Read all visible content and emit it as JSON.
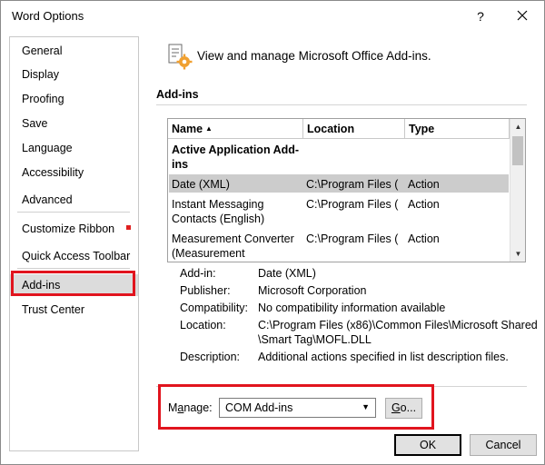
{
  "window": {
    "title": "Word Options",
    "help_label": "?"
  },
  "sidebar": {
    "items": [
      {
        "label": "General"
      },
      {
        "label": "Display"
      },
      {
        "label": "Proofing"
      },
      {
        "label": "Save"
      },
      {
        "label": "Language"
      },
      {
        "label": "Accessibility"
      },
      {
        "label": "Advanced"
      },
      {
        "label": "Customize Ribbon"
      },
      {
        "label": "Quick Access Toolbar"
      },
      {
        "label": "Add-ins"
      },
      {
        "label": "Trust Center"
      }
    ],
    "selected": "Add-ins"
  },
  "header": {
    "title": "View and manage Microsoft Office Add-ins.",
    "icon": "addins-gear-icon"
  },
  "addins": {
    "section_title": "Add-ins",
    "columns": [
      "Name",
      "Location",
      "Type"
    ],
    "group_title_line1": "Active Application Add-",
    "group_title_line2": "ins",
    "rows": [
      {
        "name_line1": "Date (XML)",
        "name_line2": "",
        "location": "C:\\Program Files (",
        "type": "Action"
      },
      {
        "name_line1": "Instant Messaging",
        "name_line2": "Contacts (English)",
        "location": "C:\\Program Files (",
        "type": "Action"
      },
      {
        "name_line1": "Measurement Converter",
        "name_line2": "(Measurement",
        "location": "C:\\Program Files (",
        "type": "Action"
      }
    ]
  },
  "details": {
    "addin_label": "Add-in:",
    "addin_value": "Date (XML)",
    "publisher_label": "Publisher:",
    "publisher_value": "Microsoft Corporation",
    "compat_label": "Compatibility:",
    "compat_value": "No compatibility information available",
    "location_label": "Location:",
    "location_value_line1": "C:\\Program Files (x86)\\Common Files\\Microsoft Shared",
    "location_value_line2": "\\Smart Tag\\MOFL.DLL",
    "description_label": "Description:",
    "description_value": "Additional actions specified in list description files."
  },
  "manage": {
    "label_prefix": "M",
    "label_accel": "a",
    "label_suffix": "nage:",
    "selected": "COM Add-ins",
    "go_accel": "G",
    "go_suffix": "o..."
  },
  "buttons": {
    "ok": "OK",
    "cancel": "Cancel"
  },
  "colors": {
    "highlight": "#e1141e",
    "selection": "#cccccc"
  }
}
